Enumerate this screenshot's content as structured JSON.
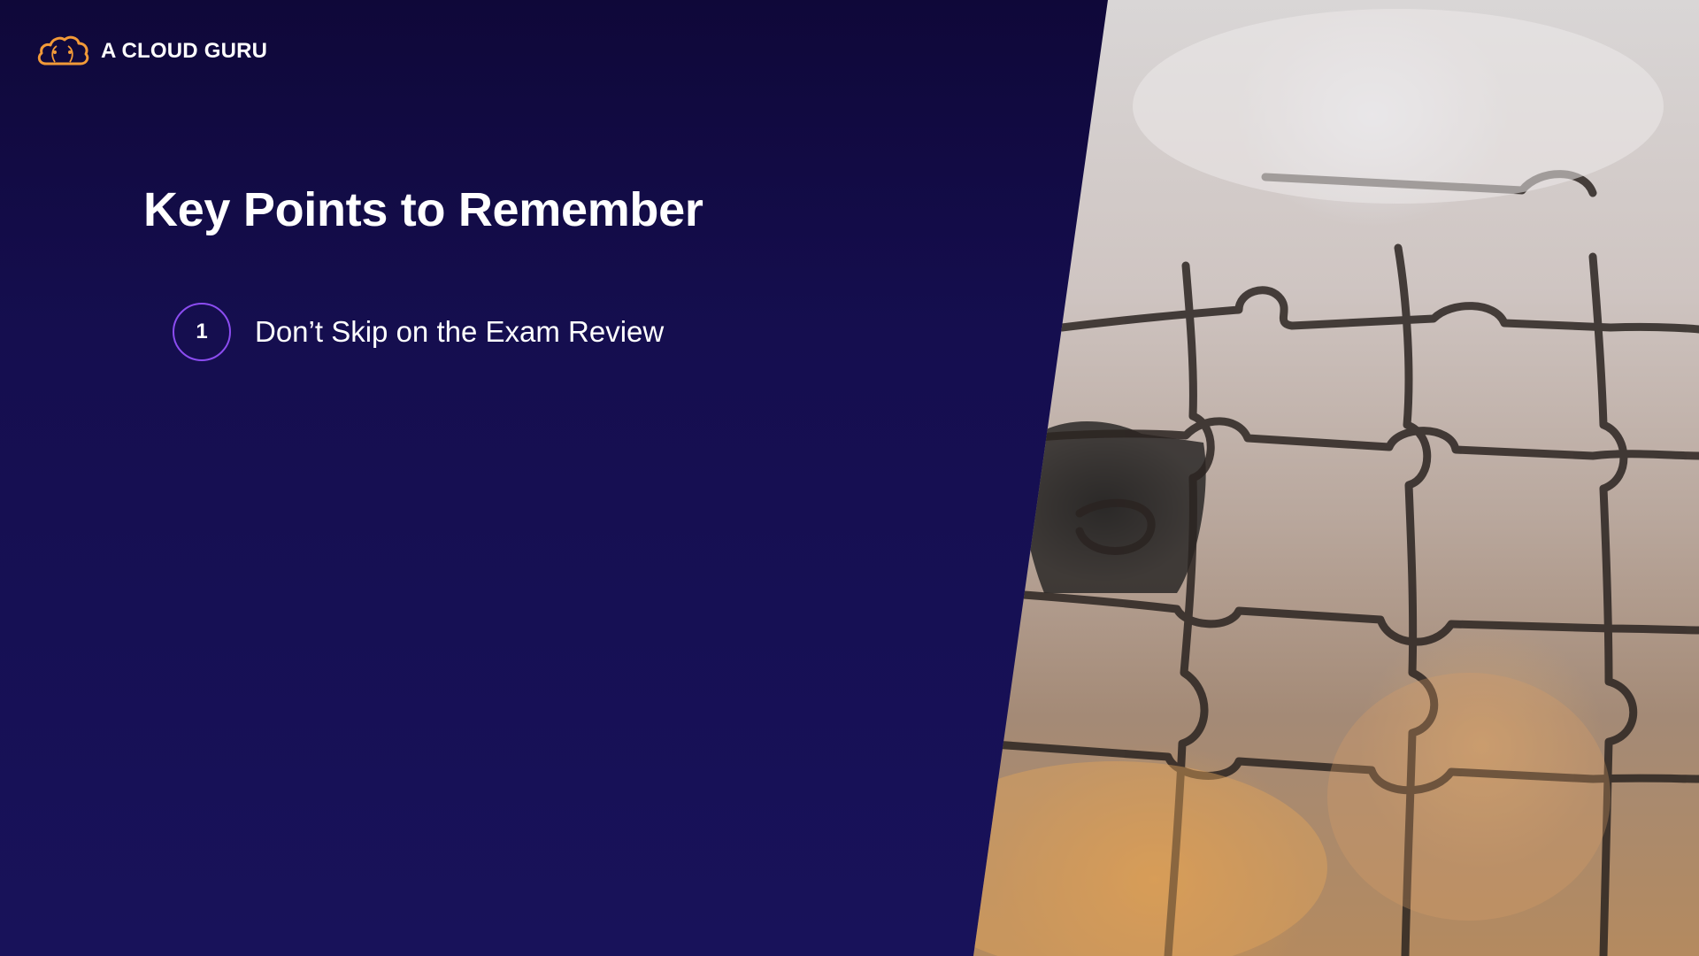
{
  "brand": {
    "name": "A CLOUD GURU",
    "logo_icon": "cloud-icon",
    "logo_color": "#f29a38"
  },
  "slide": {
    "title": "Key Points to Remember",
    "points": [
      {
        "number": "1",
        "text": "Don’t Skip on the Exam Review"
      }
    ]
  },
  "colors": {
    "background": "#150e4f",
    "accent": "#8b4cf0",
    "text": "#ffffff"
  },
  "image": {
    "subject": "puzzle-pieces-photo"
  }
}
